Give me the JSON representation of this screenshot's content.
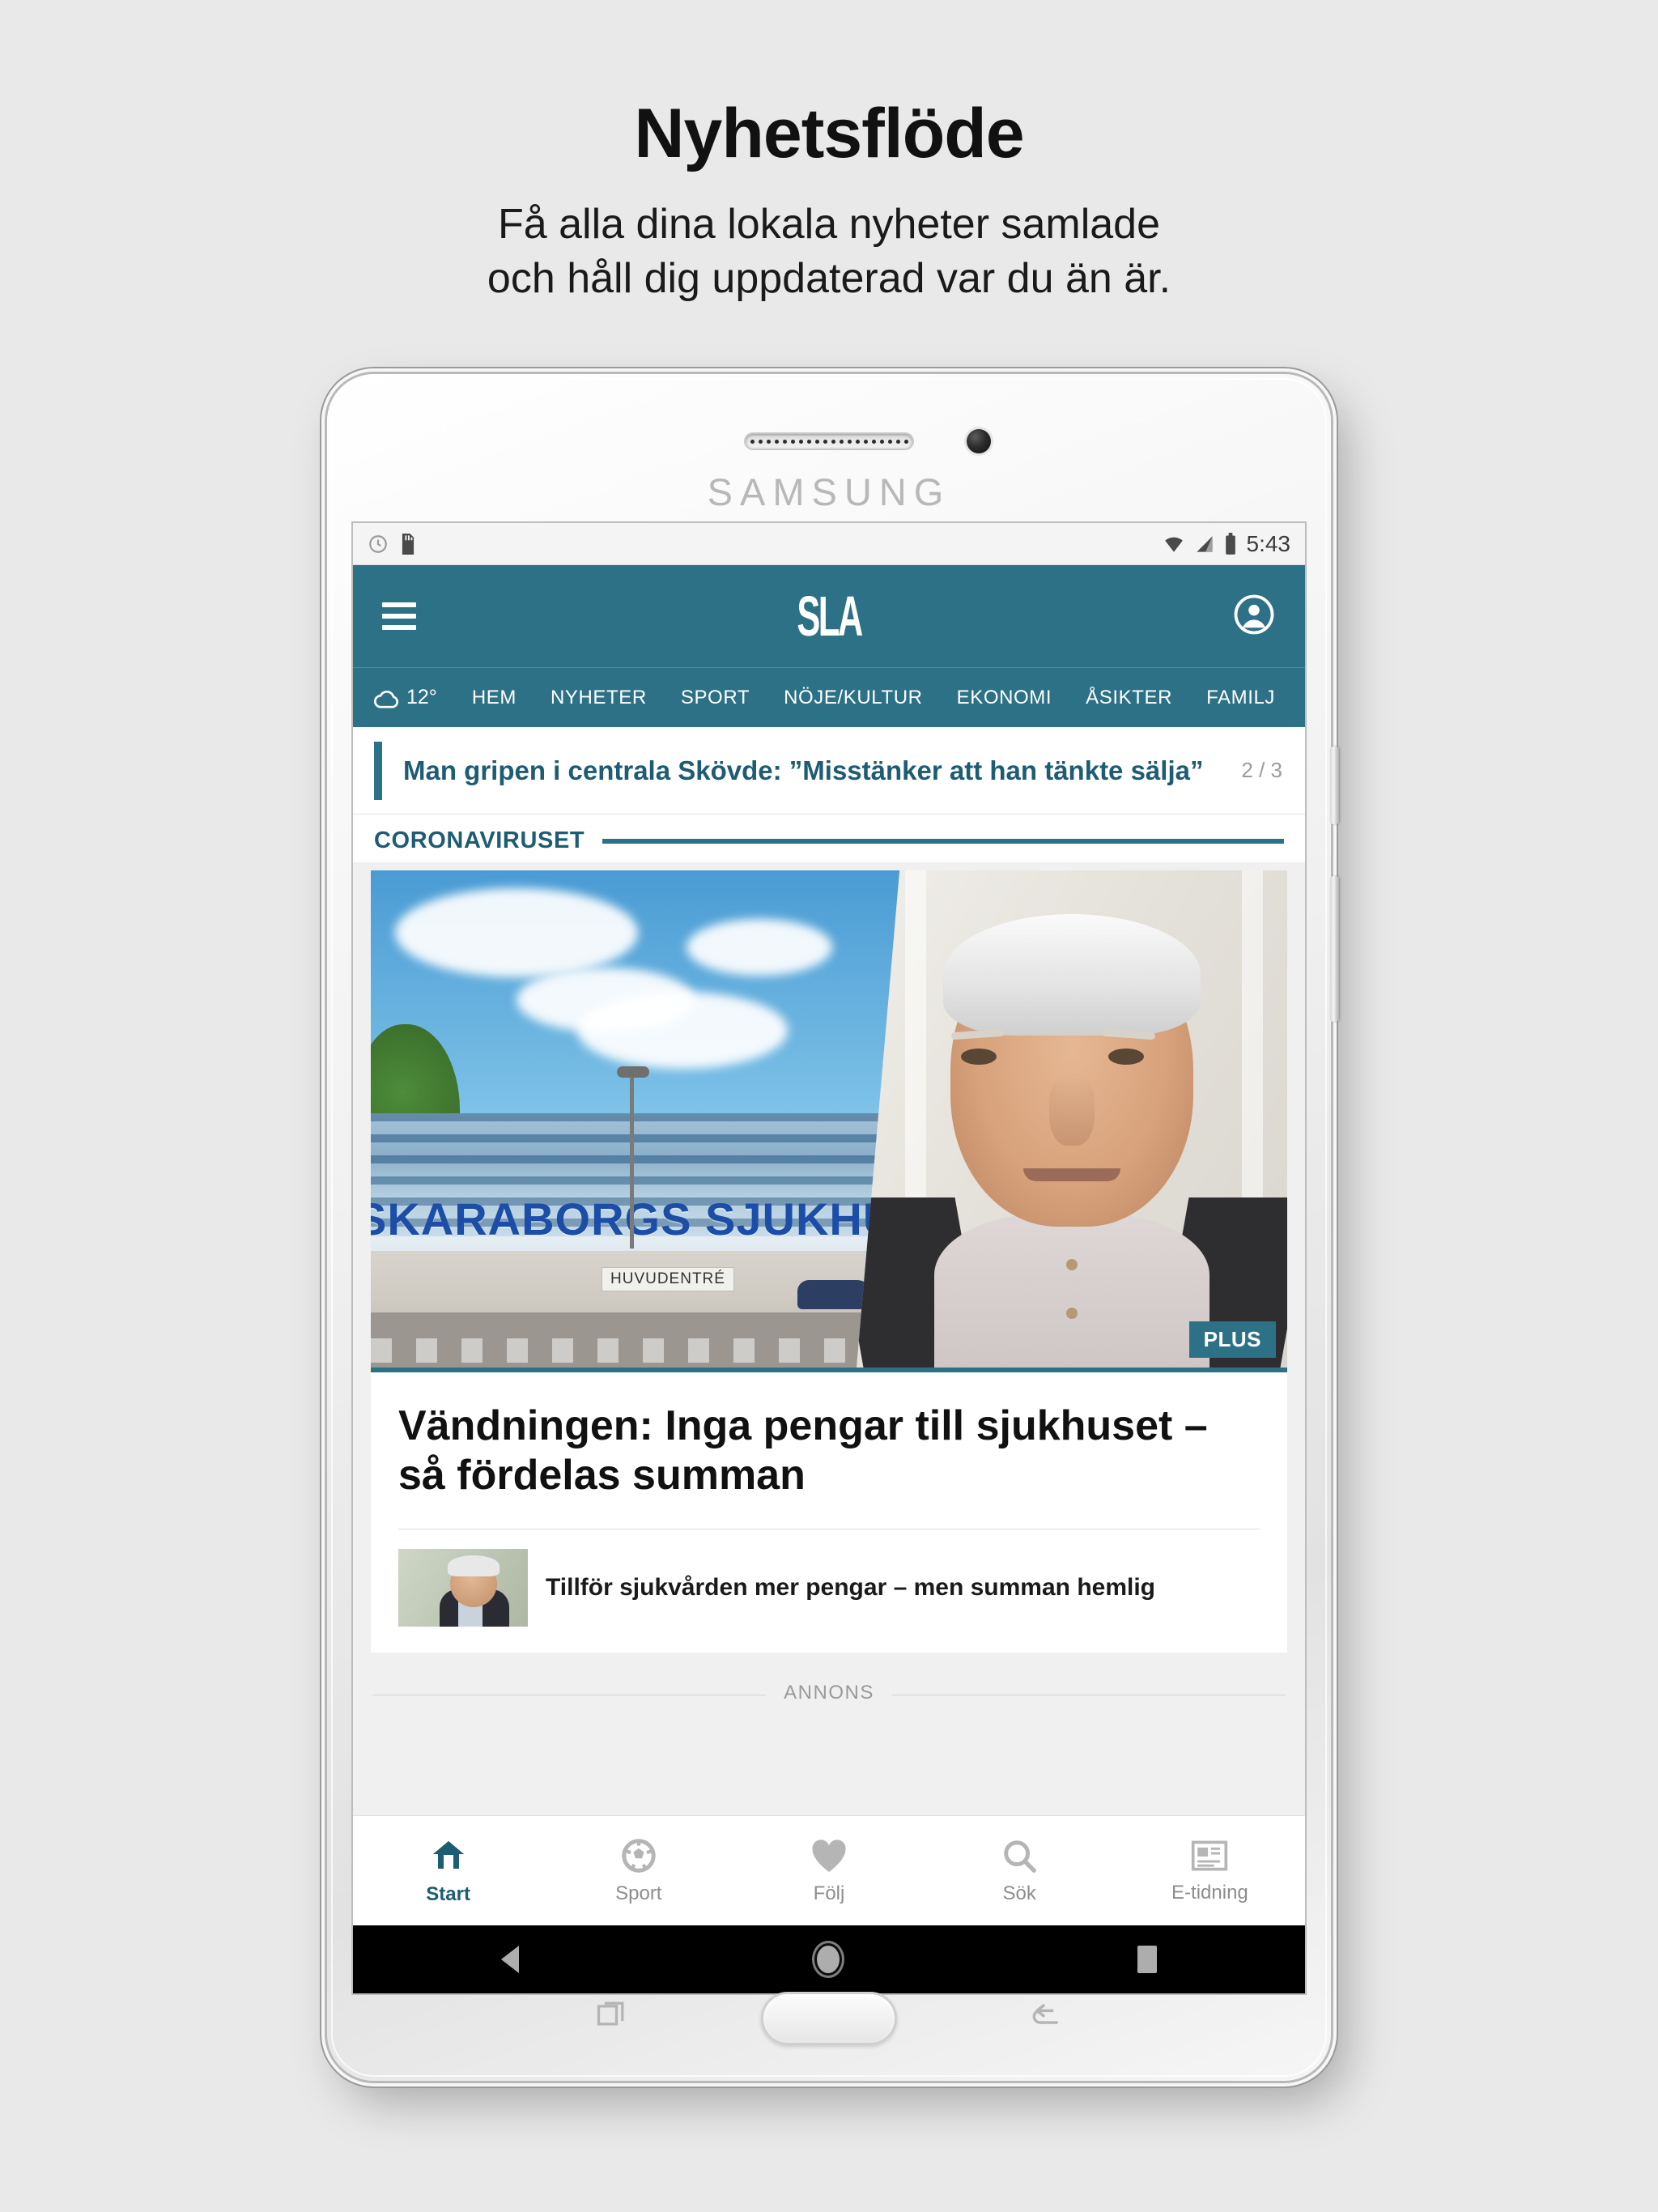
{
  "promo": {
    "title": "Nyhetsflöde",
    "subtitle_line1": "Få alla dina lokala nyheter samlade",
    "subtitle_line2": "och håll dig uppdaterad var du än är."
  },
  "device": {
    "brand": "SAMSUNG"
  },
  "statusbar": {
    "time": "5:43",
    "icons_left": [
      "clock-icon",
      "sd-card-icon"
    ],
    "icons_right": [
      "wifi-icon",
      "signal-icon",
      "battery-icon"
    ]
  },
  "app_header": {
    "menu_icon": "hamburger-menu-icon",
    "logo_text": "SLA",
    "account_icon": "account-circle-icon",
    "accent_color": "#2d7187"
  },
  "nav": {
    "weather_icon": "cloud-icon",
    "weather_temp": "12°",
    "items": [
      {
        "label": "HEM"
      },
      {
        "label": "NYHETER"
      },
      {
        "label": "SPORT"
      },
      {
        "label": "NÖJE/KULTUR"
      },
      {
        "label": "EKONOMI"
      },
      {
        "label": "ÅSIKTER"
      },
      {
        "label": "FAMILJ"
      }
    ]
  },
  "ticker": {
    "headline": "Man gripen i centrala Skövde: ”Misstänker att han tänkte sälja”",
    "counter": "2 / 3"
  },
  "section": {
    "title": "CORONAVIRUSET"
  },
  "hero": {
    "badge": "PLUS",
    "hospital_sign": "SKARABORGS SJUKHUS",
    "entrance_sign": "HUVUDENTRÉ"
  },
  "article": {
    "headline": "Vändningen: Inga pengar till sjukhuset – så fördelas summan",
    "related_title": "Tillför sjukvården mer pengar – men summan hemlig"
  },
  "ad": {
    "label": "ANNONS"
  },
  "tabbar": {
    "items": [
      {
        "label": "Start",
        "icon": "home-icon",
        "active": true
      },
      {
        "label": "Sport",
        "icon": "soccer-ball-icon",
        "active": false
      },
      {
        "label": "Följ",
        "icon": "heart-icon",
        "active": false
      },
      {
        "label": "Sök",
        "icon": "search-icon",
        "active": false
      },
      {
        "label": "E-tidning",
        "icon": "newspaper-icon",
        "active": false
      }
    ]
  },
  "android_nav": {
    "back": "back-triangle-icon",
    "home": "home-circle-icon",
    "recents": "recents-square-icon"
  }
}
